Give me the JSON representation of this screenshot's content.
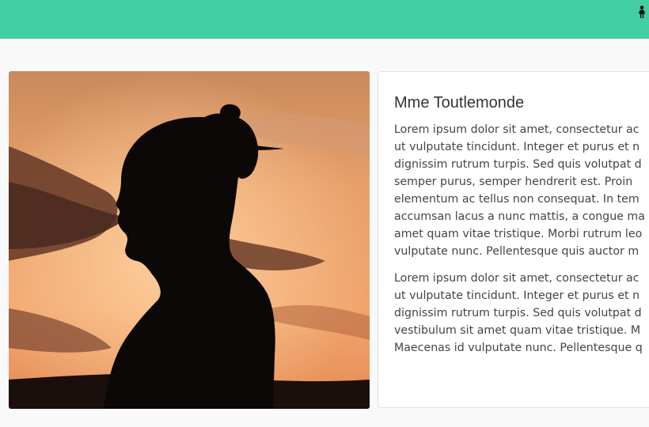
{
  "header": {
    "user_icon": "female-user-icon",
    "accent_color": "#41cfa2"
  },
  "photo": {
    "subject": "woman-silhouette-sunset"
  },
  "profile": {
    "title": "Mme Toutlemonde",
    "paragraph1": [
      "Lorem ipsum dolor sit amet, consectetur ac",
      "ut vulputate tincidunt. Integer et purus et n",
      "dignissim rutrum turpis. Sed quis volutpat d",
      "semper purus, semper hendrerit est. Proin",
      "elementum ac tellus non consequat. In tem",
      "accumsan lacus a nunc mattis, a congue ma",
      "amet quam vitae tristique. Morbi rutrum leo",
      "vulputate nunc. Pellentesque quis auctor m"
    ],
    "paragraph2": [
      "Lorem ipsum dolor sit amet, consectetur ac",
      "ut vulputate tincidunt. Integer et purus et n",
      "dignissim rutrum turpis. Sed quis volutpat d",
      "vestibulum sit amet quam vitae tristique. M",
      "Maecenas id vulputate nunc. Pellentesque q"
    ]
  }
}
